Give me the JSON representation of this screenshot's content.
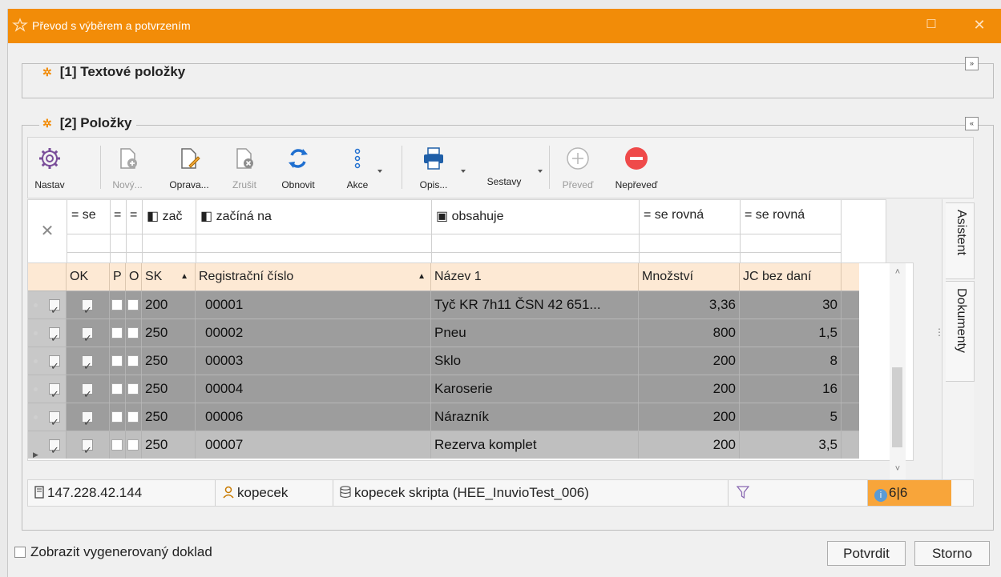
{
  "window": {
    "title": "Převod s výběrem a potvrzením"
  },
  "sections": [
    {
      "label": "[1] Textové položky",
      "collapse": "»"
    },
    {
      "label": "[2] Položky",
      "collapse": "«"
    }
  ],
  "toolbar": {
    "nastav": "Nastav",
    "novy": "Nový...",
    "oprava": "Oprava...",
    "zrusit": "Zrušit",
    "obnovit": "Obnovit",
    "akce": "Akce",
    "opis": "Opis...",
    "sestavy": "Sestavy",
    "preved": "Převeď",
    "nepreved": "Nepřeveď"
  },
  "filters": {
    "ok": "= se",
    "p": "=",
    "o": "=",
    "sk": "◧ zač",
    "reg": "◧ začíná na",
    "nazev": "▣ obsahuje",
    "mnozstvi": "= se rovná",
    "jc": "= se rovná"
  },
  "columns": {
    "ok": "OK",
    "p": "P",
    "o": "O",
    "sk": "SK",
    "reg": "Registrační číslo",
    "nazev": "Název 1",
    "mnozstvi": "Množství",
    "jc": "JC bez daní"
  },
  "rows": [
    {
      "sk": "200",
      "reg": "00001",
      "nazev": "Tyč KR 7h11 ČSN 42 651...",
      "mnozstvi": "3,36",
      "jc": "30"
    },
    {
      "sk": "250",
      "reg": "00002",
      "nazev": "Pneu",
      "mnozstvi": "800",
      "jc": "1,5"
    },
    {
      "sk": "250",
      "reg": "00003",
      "nazev": "Sklo",
      "mnozstvi": "200",
      "jc": "8"
    },
    {
      "sk": "250",
      "reg": "00004",
      "nazev": "Karoserie",
      "mnozstvi": "200",
      "jc": "16"
    },
    {
      "sk": "250",
      "reg": "00006",
      "nazev": "Nárazník",
      "mnozstvi": "200",
      "jc": "5"
    },
    {
      "sk": "250",
      "reg": "00007",
      "nazev": "Rezerva komplet",
      "mnozstvi": "200",
      "jc": "3,5"
    }
  ],
  "status": {
    "ip": "147.228.42.144",
    "user": "kopecek",
    "db": "kopecek skripta (HEE_InuvioTest_006)",
    "count": "6|6"
  },
  "sidetabs": {
    "asistent": "Asistent",
    "dokumenty": "Dokumenty"
  },
  "footer": {
    "checkbox_label": "Zobrazit vygenerovaný doklad",
    "confirm": "Potvrdit",
    "cancel": "Storno"
  },
  "colors": {
    "title_bar": "#f28c08",
    "header_bg": "#fde9d4",
    "row_bg": "#9d9d9d",
    "count_bg": "#f8a53a"
  }
}
